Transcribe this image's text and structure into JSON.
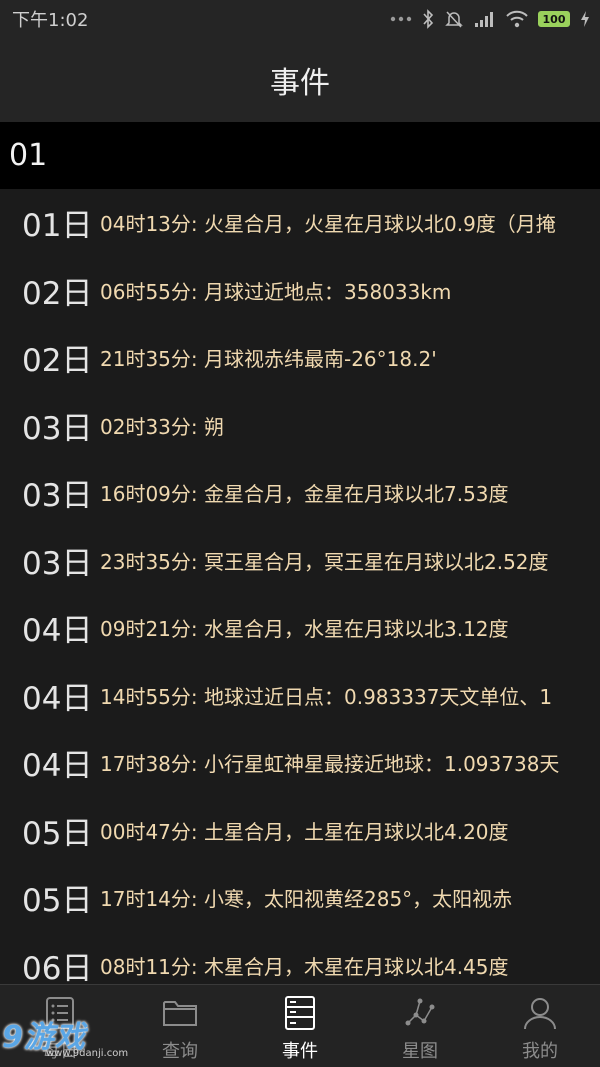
{
  "status_bar": {
    "time": "下午1:02",
    "battery": "100"
  },
  "header": {
    "title": "事件"
  },
  "month": {
    "label": "01"
  },
  "events": [
    {
      "day": "01日",
      "text": "04时13分: 火星合月，火星在月球以北0.9度（月掩"
    },
    {
      "day": "02日",
      "text": "06时55分: 月球过近地点：358033km"
    },
    {
      "day": "02日",
      "text": "21时35分: 月球视赤纬最南-26°18.2'"
    },
    {
      "day": "03日",
      "text": "02时33分: 朔"
    },
    {
      "day": "03日",
      "text": "16时09分: 金星合月，金星在月球以北7.53度"
    },
    {
      "day": "03日",
      "text": "23时35分: 冥王星合月，冥王星在月球以北2.52度"
    },
    {
      "day": "04日",
      "text": "09时21分: 水星合月，水星在月球以北3.12度"
    },
    {
      "day": "04日",
      "text": "14时55分: 地球过近日点：0.983337天文单位、1"
    },
    {
      "day": "04日",
      "text": "17时38分: 小行星虹神星最接近地球：1.093738天"
    },
    {
      "day": "05日",
      "text": "00时47分: 土星合月，土星在月球以北4.20度"
    },
    {
      "day": "05日",
      "text": "17时14分: 小寒，太阳视黄经285°，太阳视赤"
    },
    {
      "day": "06日",
      "text": "08时11分: 木星合月，木星在月球以北4.45度"
    }
  ],
  "nav": {
    "items": [
      {
        "label": "每日",
        "icon": "list-icon"
      },
      {
        "label": "查询",
        "icon": "folder-icon"
      },
      {
        "label": "事件",
        "icon": "server-list-icon",
        "active": true
      },
      {
        "label": "星图",
        "icon": "constellation-icon"
      },
      {
        "label": "我的",
        "icon": "person-icon"
      }
    ]
  },
  "watermark": {
    "main": "9游戏",
    "sub": "www.9danji.com"
  },
  "colors": {
    "background": "#1b1b1b",
    "header_bg": "#252525",
    "month_bar_bg": "#000000",
    "event_text": "#f0d9b0",
    "nav_active": "#ffffff",
    "nav_inactive": "#8c8c8c",
    "battery": "#9ad15c"
  }
}
